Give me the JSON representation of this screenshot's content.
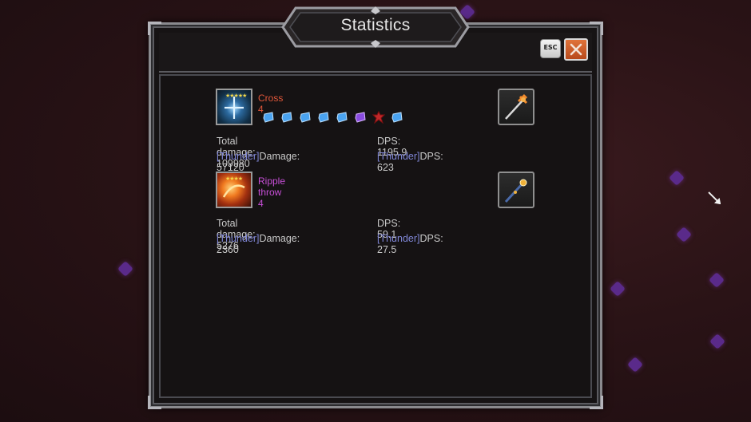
{
  "title": "Statistics",
  "esc_label": "ESC",
  "weapons": [
    {
      "name": "Cross 4",
      "name_color": "#e2573a",
      "stars": "★★★★★",
      "gems": [
        "blue",
        "blue",
        "blue",
        "blue",
        "blue",
        "purple",
        "red",
        "blue"
      ],
      "total_damage": "Total damage: 109980",
      "dps": "DPS: 1195.9",
      "thunder_tag": "[Thunder]",
      "thunder_damage": "Damage: 57120",
      "thunder_dps": "DPS: 623",
      "equipped_icon": "cross-staff-icon"
    },
    {
      "name": "Ripple throw 4",
      "name_color": "#c84fd8",
      "stars": "★★★★",
      "gems": [],
      "total_damage": "Total damage: 5276",
      "dps": "DPS: 59.1",
      "thunder_tag": "[Thunder]",
      "thunder_damage": "Damage: 2360",
      "thunder_dps": "DPS: 27.5",
      "equipped_icon": "scepter-icon"
    }
  ],
  "colors": {
    "gem_blue": "#4aa3f0",
    "gem_purple": "#8a4ce0",
    "gem_red": "#c0282a",
    "thunder_tag": "#7f86d6"
  }
}
